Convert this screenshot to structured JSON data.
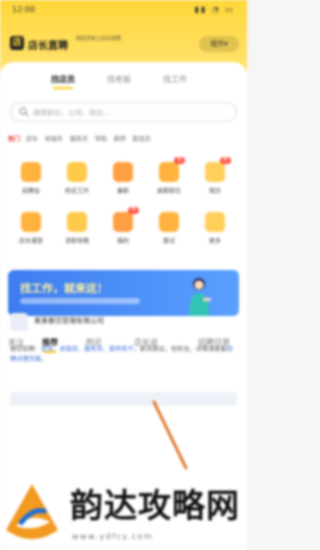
{
  "statusbar": {
    "time": "12:00",
    "icons": "▮▮ ◔ ▭"
  },
  "brand": {
    "logo_letter": "店",
    "name": "店长直聘",
    "slogan": "招店员就上店长直聘",
    "city": "城市▾"
  },
  "segment_tabs": [
    "找店员",
    "找老板",
    "找工作"
  ],
  "search": {
    "placeholder": "搜索职位、公司、岗位…"
  },
  "hot_words": {
    "tag": "热门",
    "words": [
      "店长",
      "收银员",
      "服务员",
      "导购",
      "厨师",
      "配送员"
    ]
  },
  "grid": [
    {
      "label": "招聘会",
      "color": "#ffb23d"
    },
    {
      "label": "附近工作",
      "color": "#ffc94a"
    },
    {
      "label": "兼职",
      "color": "#ff9f43"
    },
    {
      "label": "高薪职位",
      "color": "#ffb23d",
      "badge": "热"
    },
    {
      "label": "简历",
      "color": "#ffcf5a",
      "badge": "新"
    },
    {
      "label": "店长课堂",
      "color": "#ffb23d"
    },
    {
      "label": "求职攻略",
      "color": "#ffc94a"
    },
    {
      "label": "福利",
      "color": "#ff9f43",
      "badge": "热"
    },
    {
      "label": "面试",
      "color": "#ffb23d"
    },
    {
      "label": "更多",
      "color": "#ffcf5a"
    }
  ],
  "banner": {
    "title": "找工作，就来这！"
  },
  "feed_tabs": [
    "关注",
    "推荐",
    "附近",
    "店长说",
    "招聘日常"
  ],
  "feed_active": "推荐",
  "post": {
    "company": "某某餐饮管理有限公司",
    "text_lead": "餐饮招聘：",
    "link1": "店长、收银员、服务员、厨师若干",
    "text_mid": "，薪资面议，包吃住。详情请查看",
    "link2": "招聘详情页面",
    "text_end": "。"
  },
  "watermark": {
    "title": "韵达攻略网",
    "url": "www.ydfcy.com"
  },
  "colors": {
    "brand_yellow": "#ffd739",
    "banner_blue": "#3d7cf0",
    "link_blue": "#3a6fd8",
    "hot_red": "#e23b2a"
  }
}
